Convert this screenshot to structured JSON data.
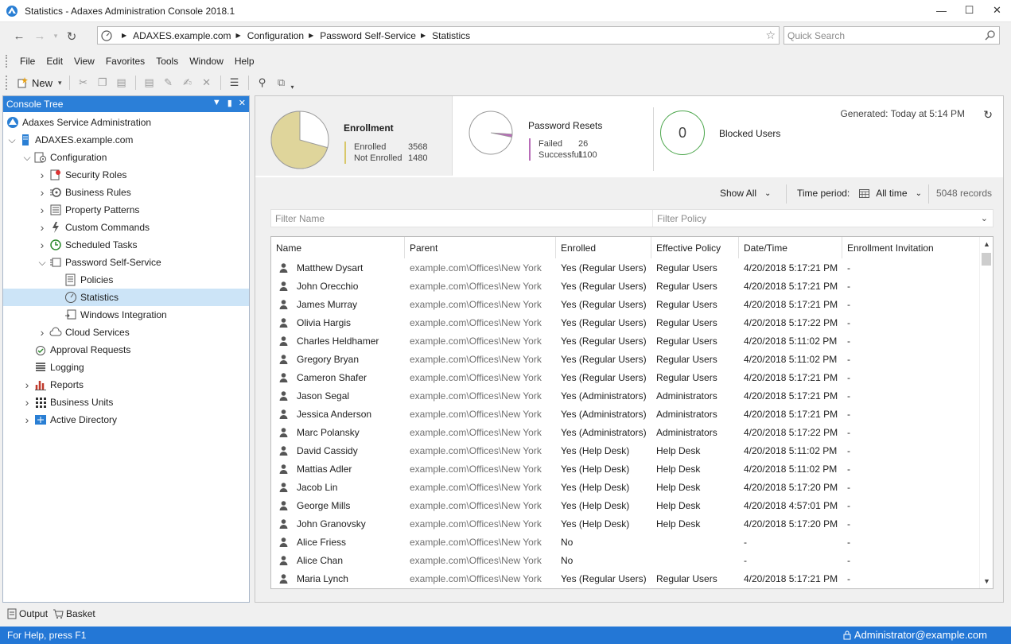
{
  "window": {
    "title": "Statistics - Adaxes Administration Console 2018.1",
    "controls": [
      "minimize",
      "maximize",
      "close"
    ]
  },
  "nav": {
    "breadcrumbs": [
      "ADAXES.example.com",
      "Configuration",
      "Password Self-Service",
      "Statistics"
    ],
    "quick_search_placeholder": "Quick Search"
  },
  "menu": [
    "File",
    "Edit",
    "View",
    "Favorites",
    "Tools",
    "Window",
    "Help"
  ],
  "toolbar": {
    "new_label": "New"
  },
  "tree": {
    "header": "Console Tree",
    "items": [
      {
        "label": "Adaxes Service Administration",
        "expander": "",
        "icon": "adaxes-logo-icon"
      },
      {
        "label": "ADAXES.example.com",
        "expander": "open",
        "icon": "server-icon"
      },
      {
        "label": "Configuration",
        "expander": "open",
        "icon": "configuration-icon"
      },
      {
        "label": "Security Roles",
        "expander": "closed",
        "icon": "security-roles-icon"
      },
      {
        "label": "Business Rules",
        "expander": "closed",
        "icon": "business-rules-icon"
      },
      {
        "label": "Property Patterns",
        "expander": "closed",
        "icon": "property-patterns-icon"
      },
      {
        "label": "Custom Commands",
        "expander": "closed",
        "icon": "custom-commands-icon"
      },
      {
        "label": "Scheduled Tasks",
        "expander": "closed",
        "icon": "scheduled-tasks-icon"
      },
      {
        "label": "Password Self-Service",
        "expander": "open",
        "icon": "password-self-service-icon"
      },
      {
        "label": "Policies",
        "expander": "",
        "icon": "policies-icon"
      },
      {
        "label": "Statistics",
        "expander": "",
        "icon": "statistics-icon"
      },
      {
        "label": "Windows Integration",
        "expander": "",
        "icon": "windows-integration-icon"
      },
      {
        "label": "Cloud Services",
        "expander": "closed",
        "icon": "cloud-services-icon"
      },
      {
        "label": "Approval Requests",
        "expander": "",
        "icon": "approval-requests-icon"
      },
      {
        "label": "Logging",
        "expander": "",
        "icon": "logging-icon"
      },
      {
        "label": "Reports",
        "expander": "closed",
        "icon": "reports-icon"
      },
      {
        "label": "Business Units",
        "expander": "closed",
        "icon": "business-units-icon"
      },
      {
        "label": "Active Directory",
        "expander": "closed",
        "icon": "active-directory-icon"
      }
    ]
  },
  "bottom_tabs": [
    "Output",
    "Basket"
  ],
  "status": {
    "help": "For Help, press F1",
    "user": "Administrator@example.com"
  },
  "stats": {
    "enrollment": {
      "title": "Enrollment",
      "enrolled_label": "Enrolled",
      "enrolled": "3568",
      "not_enrolled_label": "Not Enrolled",
      "not_enrolled": "1480",
      "enrolled_fraction": 0.707
    },
    "resets": {
      "title": "Password Resets",
      "failed_label": "Failed",
      "failed": "26",
      "successful_label": "Successful",
      "successful": "1100",
      "failed_fraction": 0.023
    },
    "blocked": {
      "count": "0",
      "label": "Blocked Users"
    },
    "generated": "Generated: Today at 5:14 PM"
  },
  "filters": {
    "show_all": "Show All",
    "time_period_label": "Time period:",
    "time_period_value": "All time",
    "records": "5048 records",
    "filter_name_placeholder": "Filter Name",
    "filter_policy_placeholder": "Filter Policy"
  },
  "grid": {
    "columns": [
      "Name",
      "Parent",
      "Enrolled",
      "Effective Policy",
      "Date/Time",
      "Enrollment Invitation"
    ],
    "rows": [
      [
        "Matthew Dysart",
        "example.com\\Offices\\New York",
        "Yes (Regular Users)",
        "Regular Users",
        "4/20/2018 5:17:21 PM",
        "-"
      ],
      [
        "John Orecchio",
        "example.com\\Offices\\New York",
        "Yes (Regular Users)",
        "Regular Users",
        "4/20/2018 5:17:21 PM",
        "-"
      ],
      [
        "James Murray",
        "example.com\\Offices\\New York",
        "Yes (Regular Users)",
        "Regular Users",
        "4/20/2018 5:17:21 PM",
        "-"
      ],
      [
        "Olivia Hargis",
        "example.com\\Offices\\New York",
        "Yes (Regular Users)",
        "Regular Users",
        "4/20/2018 5:17:22 PM",
        "-"
      ],
      [
        "Charles Heldhamer",
        "example.com\\Offices\\New York",
        "Yes (Regular Users)",
        "Regular Users",
        "4/20/2018 5:11:02 PM",
        "-"
      ],
      [
        "Gregory Bryan",
        "example.com\\Offices\\New York",
        "Yes (Regular Users)",
        "Regular Users",
        "4/20/2018 5:11:02 PM",
        "-"
      ],
      [
        "Cameron Shafer",
        "example.com\\Offices\\New York",
        "Yes (Regular Users)",
        "Regular Users",
        "4/20/2018 5:17:21 PM",
        "-"
      ],
      [
        "Jason Segal",
        "example.com\\Offices\\New York",
        "Yes (Administrators)",
        "Administrators",
        "4/20/2018 5:17:21 PM",
        "-"
      ],
      [
        "Jessica Anderson",
        "example.com\\Offices\\New York",
        "Yes (Administrators)",
        "Administrators",
        "4/20/2018 5:17:21 PM",
        "-"
      ],
      [
        "Marc Polansky",
        "example.com\\Offices\\New York",
        "Yes (Administrators)",
        "Administrators",
        "4/20/2018 5:17:22 PM",
        "-"
      ],
      [
        "David Cassidy",
        "example.com\\Offices\\New York",
        "Yes (Help Desk)",
        "Help Desk",
        "4/20/2018 5:11:02 PM",
        "-"
      ],
      [
        "Mattias Adler",
        "example.com\\Offices\\New York",
        "Yes (Help Desk)",
        "Help Desk",
        "4/20/2018 5:11:02 PM",
        "-"
      ],
      [
        "Jacob Lin",
        "example.com\\Offices\\New York",
        "Yes (Help Desk)",
        "Help Desk",
        "4/20/2018 5:17:20 PM",
        "-"
      ],
      [
        "George Mills",
        "example.com\\Offices\\New York",
        "Yes (Help Desk)",
        "Help Desk",
        "4/20/2018 4:57:01 PM",
        "-"
      ],
      [
        "John Granovsky",
        "example.com\\Offices\\New York",
        "Yes (Help Desk)",
        "Help Desk",
        "4/20/2018 5:17:20 PM",
        "-"
      ],
      [
        "Alice Friess",
        "example.com\\Offices\\New York",
        "No",
        "",
        "-",
        "-"
      ],
      [
        "Alice Chan",
        "example.com\\Offices\\New York",
        "No",
        "",
        "-",
        "-"
      ],
      [
        "Maria Lynch",
        "example.com\\Offices\\New York",
        "Yes (Regular Users)",
        "Regular Users",
        "4/20/2018 5:17:21 PM",
        "-"
      ]
    ]
  }
}
